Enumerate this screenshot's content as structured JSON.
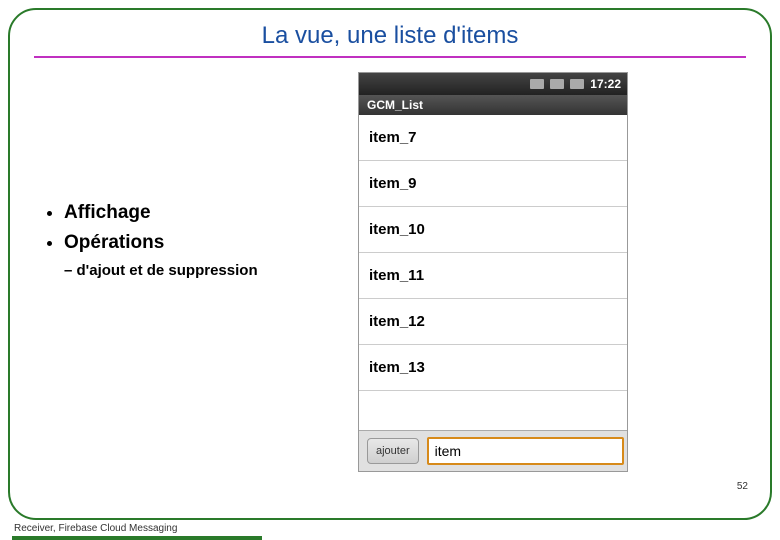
{
  "slide": {
    "title": "La vue, une liste d'items",
    "bullets": {
      "b1": "Affichage",
      "b2": "Opérations",
      "b2_sub": "d'ajout et de suppression"
    },
    "footer": "Receiver, Firebase Cloud Messaging",
    "page_no": "52"
  },
  "phone": {
    "status_time": "17:22",
    "app_title": "GCM_List",
    "items": [
      "item_7",
      "item_9",
      "item_10",
      "item_11",
      "item_12",
      "item_13"
    ],
    "button_label": "ajouter",
    "input_value": "item"
  }
}
